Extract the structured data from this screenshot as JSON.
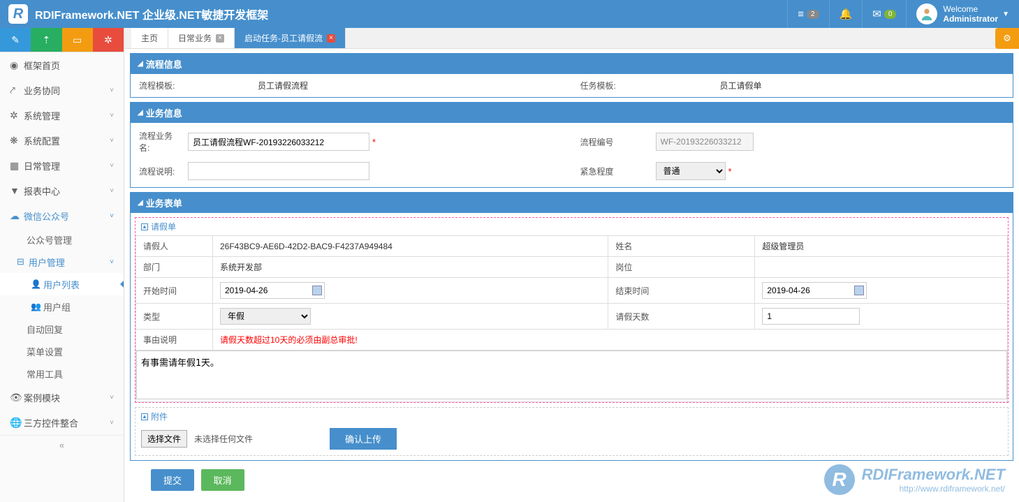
{
  "header": {
    "brand": "RDIFramework.NET 企业级.NET敏捷开发框架",
    "notif_count": "2",
    "mail_count": "0",
    "welcome": "Welcome",
    "username": "Administrator"
  },
  "sidebar": {
    "items": [
      {
        "icon": "◐",
        "label": "框架首页",
        "chev": ""
      },
      {
        "icon": "⇄",
        "label": "业务协同",
        "chev": "˅"
      },
      {
        "icon": "✲",
        "label": "系统管理",
        "chev": "˅"
      },
      {
        "icon": "❋",
        "label": "系统配置",
        "chev": "˅"
      },
      {
        "icon": "▦",
        "label": "日常管理",
        "chev": "˅"
      },
      {
        "icon": "▼",
        "label": "报表中心",
        "chev": "˅"
      },
      {
        "icon": "☁",
        "label": "微信公众号",
        "chev": "˅",
        "expanded": true
      },
      {
        "icon": "👁",
        "label": "案例模块",
        "chev": "˅"
      },
      {
        "icon": "🌐",
        "label": "三方控件整合",
        "chev": "˅"
      }
    ],
    "wechat_subs": [
      {
        "label": "公众号管理"
      },
      {
        "label": "用户管理",
        "expanded": true
      },
      {
        "label": "自动回复"
      },
      {
        "label": "菜单设置"
      },
      {
        "label": "常用工具"
      }
    ],
    "user_mgmt_subs": [
      {
        "icon": "👤",
        "label": "用户列表",
        "active": true
      },
      {
        "icon": "👥",
        "label": "用户组"
      }
    ]
  },
  "tabs": [
    {
      "label": "主页",
      "closable": false
    },
    {
      "label": "日常业务",
      "closable": true
    },
    {
      "label": "启动任务-员工请假流",
      "closable": true,
      "active": true
    }
  ],
  "panels": {
    "process_info": {
      "title": "流程信息",
      "template_label": "流程模板:",
      "template_value": "员工请假流程",
      "task_label": "任务模板:",
      "task_value": "员工请假单"
    },
    "biz_info": {
      "title": "业务信息",
      "name_label": "流程业务名:",
      "name_value": "员工请假流程WF-20193226033212",
      "no_label": "流程编号",
      "no_value": "WF-20193226033212",
      "desc_label": "流程说明:",
      "desc_value": "",
      "urgency_label": "紧急程度",
      "urgency_value": "普通"
    },
    "biz_form": {
      "title": "业务表单",
      "sub_title": "请假单",
      "applicant_label": "请假人",
      "applicant_value": "26F43BC9-AE6D-42D2-BAC9-F4237A949484",
      "name_label": "姓名",
      "name_value": "超级管理员",
      "dept_label": "部门",
      "dept_value": "系统开发部",
      "post_label": "岗位",
      "post_value": "",
      "start_label": "开始时间",
      "start_value": "2019-04-26",
      "end_label": "结束时间",
      "end_value": "2019-04-26",
      "type_label": "类型",
      "type_value": "年假",
      "days_label": "请假天数",
      "days_value": "1",
      "reason_label": "事由说明",
      "reason_hint": "请假天数超过10天的必须由副总审批!",
      "reason_value": "有事需请年假1天。",
      "attach_title": "附件",
      "file_btn": "选择文件",
      "file_empty": "未选择任何文件",
      "upload_btn": "确认上传"
    }
  },
  "actions": {
    "submit": "提交",
    "cancel": "取消"
  },
  "watermark": {
    "big": "RDIFramework.NET",
    "url": "http://www.rdiframework.net/"
  }
}
